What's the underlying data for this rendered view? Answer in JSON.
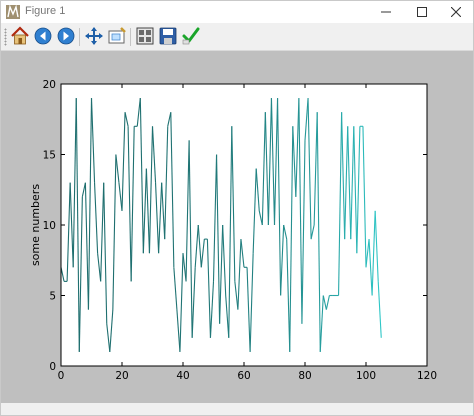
{
  "window": {
    "title": "Figure 1"
  },
  "toolbar": {
    "buttons": [
      {
        "name": "home-button",
        "icon": "home-icon"
      },
      {
        "name": "back-button",
        "icon": "arrow-left-icon"
      },
      {
        "name": "forward-button",
        "icon": "arrow-right-icon"
      },
      {
        "name": "pan-button",
        "icon": "move-icon"
      },
      {
        "name": "zoom-button",
        "icon": "zoom-rect-icon"
      },
      {
        "name": "subplots-button",
        "icon": "subplots-icon"
      },
      {
        "name": "save-button",
        "icon": "floppy-icon"
      },
      {
        "name": "edit-button",
        "icon": "checkmark-icon"
      }
    ]
  },
  "chart_data": {
    "type": "line",
    "title": "",
    "xlabel": "",
    "ylabel": "some numbers",
    "xlim": [
      0,
      120
    ],
    "ylim": [
      0,
      20
    ],
    "xticks": [
      0,
      20,
      40,
      60,
      80,
      100,
      120
    ],
    "yticks": [
      0,
      5,
      10,
      15,
      20
    ],
    "grid": false,
    "colors": {
      "start": "#1f6f6f",
      "end": "#2ec6c6"
    },
    "series": [
      {
        "values": [
          7,
          6,
          6,
          13,
          7,
          19,
          1,
          12,
          13,
          4,
          19,
          13,
          8,
          6,
          13,
          3,
          1,
          4,
          15,
          13,
          11,
          18,
          17,
          6,
          17,
          17,
          19,
          8,
          14,
          8,
          17,
          13,
          8,
          13,
          9,
          17,
          18,
          7,
          4,
          1,
          8,
          6,
          16,
          2,
          7,
          10,
          7,
          9,
          9,
          2,
          6,
          15,
          3,
          10,
          5,
          2,
          17,
          6,
          4,
          9,
          7,
          7,
          1,
          8,
          14,
          11,
          10,
          18,
          10,
          19,
          10,
          19,
          5,
          10,
          9,
          1,
          17,
          12,
          19,
          3,
          16,
          19,
          9,
          10,
          18,
          1,
          5,
          4,
          5,
          5,
          5,
          5,
          18,
          9,
          17,
          9,
          17,
          8,
          17,
          17,
          7,
          9,
          5,
          11,
          6,
          2
        ]
      }
    ]
  }
}
